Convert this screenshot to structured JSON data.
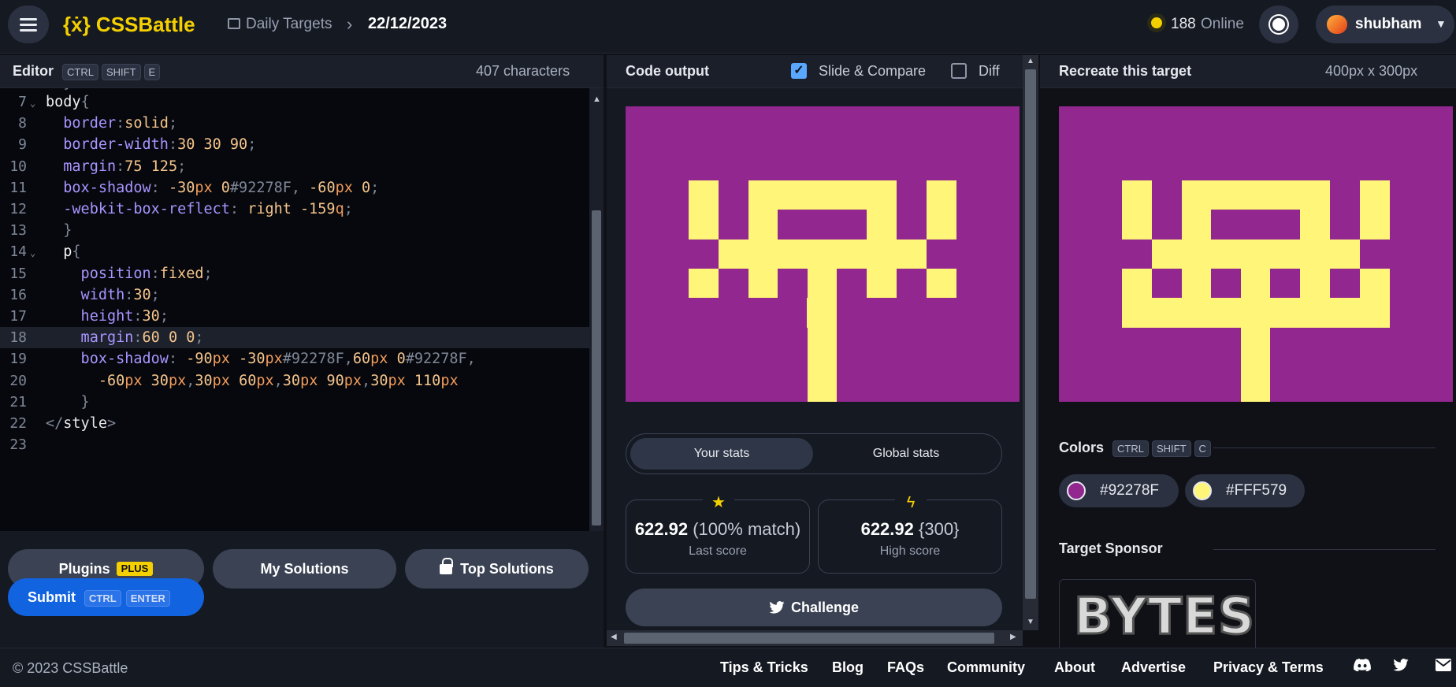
{
  "topbar": {
    "brand": "{ẋ} CSSBattle",
    "breadcrumb_section": "Daily Targets",
    "breadcrumb_current": "22/12/2023",
    "online_count": "188",
    "online_label": "Online",
    "username": "shubham"
  },
  "editor": {
    "title": "Editor",
    "shortcut": [
      "CTRL",
      "SHIFT",
      "E"
    ],
    "char_count": "407 characters",
    "lines": [
      {
        "num": "7",
        "fold": true,
        "tokens": [
          [
            "sel",
            "body"
          ],
          [
            "pun",
            "{"
          ]
        ]
      },
      {
        "num": "8",
        "tokens": [
          [
            "prop",
            "  border"
          ],
          [
            "pun",
            ":"
          ],
          [
            "val",
            "solid"
          ],
          [
            "pun",
            ";"
          ]
        ]
      },
      {
        "num": "9",
        "tokens": [
          [
            "prop",
            "  border-width"
          ],
          [
            "pun",
            ":"
          ],
          [
            "val",
            "30 30 90"
          ],
          [
            "pun",
            ";"
          ]
        ]
      },
      {
        "num": "10",
        "tokens": [
          [
            "prop",
            "  margin"
          ],
          [
            "pun",
            ":"
          ],
          [
            "val",
            "75 125"
          ],
          [
            "pun",
            ";"
          ]
        ]
      },
      {
        "num": "11",
        "tokens": [
          [
            "prop",
            "  box-shadow"
          ],
          [
            "pun",
            ": "
          ],
          [
            "val",
            "-30"
          ],
          [
            "unit",
            "px"
          ],
          [
            "val",
            " 0"
          ],
          [
            "pun",
            "#92278F, "
          ],
          [
            "val",
            "-60"
          ],
          [
            "unit",
            "px"
          ],
          [
            "val",
            " 0"
          ],
          [
            "pun",
            ";"
          ]
        ]
      },
      {
        "num": "12",
        "tokens": [
          [
            "prop",
            "  -webkit-box-reflect"
          ],
          [
            "pun",
            ": "
          ],
          [
            "val",
            "right -159"
          ],
          [
            "unit",
            "q"
          ],
          [
            "pun",
            ";"
          ]
        ]
      },
      {
        "num": "13",
        "tokens": [
          [
            "pun",
            "  }"
          ]
        ]
      },
      {
        "num": "14",
        "fold": true,
        "tokens": [
          [
            "sel",
            "  p"
          ],
          [
            "pun",
            "{"
          ]
        ]
      },
      {
        "num": "15",
        "tokens": [
          [
            "prop",
            "    position"
          ],
          [
            "pun",
            ":"
          ],
          [
            "val",
            "fixed"
          ],
          [
            "pun",
            ";"
          ]
        ]
      },
      {
        "num": "16",
        "tokens": [
          [
            "prop",
            "    width"
          ],
          [
            "pun",
            ":"
          ],
          [
            "val",
            "30"
          ],
          [
            "pun",
            ";"
          ]
        ]
      },
      {
        "num": "17",
        "tokens": [
          [
            "prop",
            "    height"
          ],
          [
            "pun",
            ":"
          ],
          [
            "val",
            "30"
          ],
          [
            "pun",
            ";"
          ]
        ]
      },
      {
        "num": "18",
        "active": true,
        "tokens": [
          [
            "prop",
            "    margin"
          ],
          [
            "pun",
            ":"
          ],
          [
            "val",
            "60 0 0"
          ],
          [
            "pun",
            ";"
          ]
        ]
      },
      {
        "num": "19",
        "tokens": [
          [
            "prop",
            "    box-shadow"
          ],
          [
            "pun",
            ": "
          ],
          [
            "val",
            "-90"
          ],
          [
            "unit",
            "px"
          ],
          [
            "val",
            " -30"
          ],
          [
            "unit",
            "px"
          ],
          [
            "pun",
            "#92278F,"
          ],
          [
            "val",
            "60"
          ],
          [
            "unit",
            "px"
          ],
          [
            "val",
            " 0"
          ],
          [
            "pun",
            "#92278F,"
          ]
        ]
      },
      {
        "num": "20",
        "tokens": [
          [
            "val",
            "      -60"
          ],
          [
            "unit",
            "px"
          ],
          [
            "val",
            " 30"
          ],
          [
            "unit",
            "px"
          ],
          [
            "pun",
            ","
          ],
          [
            "val",
            "30"
          ],
          [
            "unit",
            "px"
          ],
          [
            "val",
            " 60"
          ],
          [
            "unit",
            "px"
          ],
          [
            "pun",
            ","
          ],
          [
            "val",
            "30"
          ],
          [
            "unit",
            "px"
          ],
          [
            "val",
            " 90"
          ],
          [
            "unit",
            "px"
          ],
          [
            "pun",
            ","
          ],
          [
            "val",
            "30"
          ],
          [
            "unit",
            "px"
          ],
          [
            "val",
            " 110"
          ],
          [
            "unit",
            "px"
          ]
        ]
      },
      {
        "num": "21",
        "tokens": [
          [
            "pun",
            "    }"
          ]
        ]
      },
      {
        "num": "22",
        "tokens": [
          [
            "pun",
            "</"
          ],
          [
            "tag",
            "style"
          ],
          [
            "pun",
            ">"
          ]
        ]
      },
      {
        "num": "23",
        "tokens": []
      }
    ]
  },
  "buttons": {
    "plugins": "Plugins",
    "plugins_badge": "PLUS",
    "my_solutions": "My Solutions",
    "top_solutions": "Top Solutions",
    "submit": "Submit",
    "submit_keys": [
      "CTRL",
      "ENTER"
    ]
  },
  "output": {
    "title": "Code output",
    "slide_compare": "Slide & Compare",
    "slide_compare_checked": true,
    "diff": "Diff",
    "diff_checked": false
  },
  "stats": {
    "tab_yours": "Your stats",
    "tab_global": "Global stats",
    "last_score": "622.92",
    "last_score_detail": "(100% match)",
    "last_score_label": "Last score",
    "high_score": "622.92",
    "high_score_detail": "{300}",
    "high_score_label": "High score",
    "challenge": "Challenge"
  },
  "target": {
    "title": "Recreate this target",
    "size": "400px x 300px",
    "colors_title": "Colors",
    "colors_shortcut": [
      "CTRL",
      "SHIFT",
      "C"
    ],
    "colors": [
      {
        "label": "#92278F",
        "hex": "#92278F"
      },
      {
        "label": "#FFF579",
        "hex": "#FFF579"
      }
    ],
    "sponsor_title": "Target Sponsor",
    "sponsor_name": "BYTES"
  },
  "footer": {
    "copyright": "© 2023 CSSBattle",
    "links": [
      "Tips & Tricks",
      "Blog",
      "FAQs",
      "Community",
      "About",
      "Advertise",
      "Privacy & Terms"
    ]
  },
  "theme": {
    "accent": "#F5D000",
    "submit_blue": "#1163E0",
    "target_bg": "#92278F",
    "target_fg": "#FFF579"
  }
}
